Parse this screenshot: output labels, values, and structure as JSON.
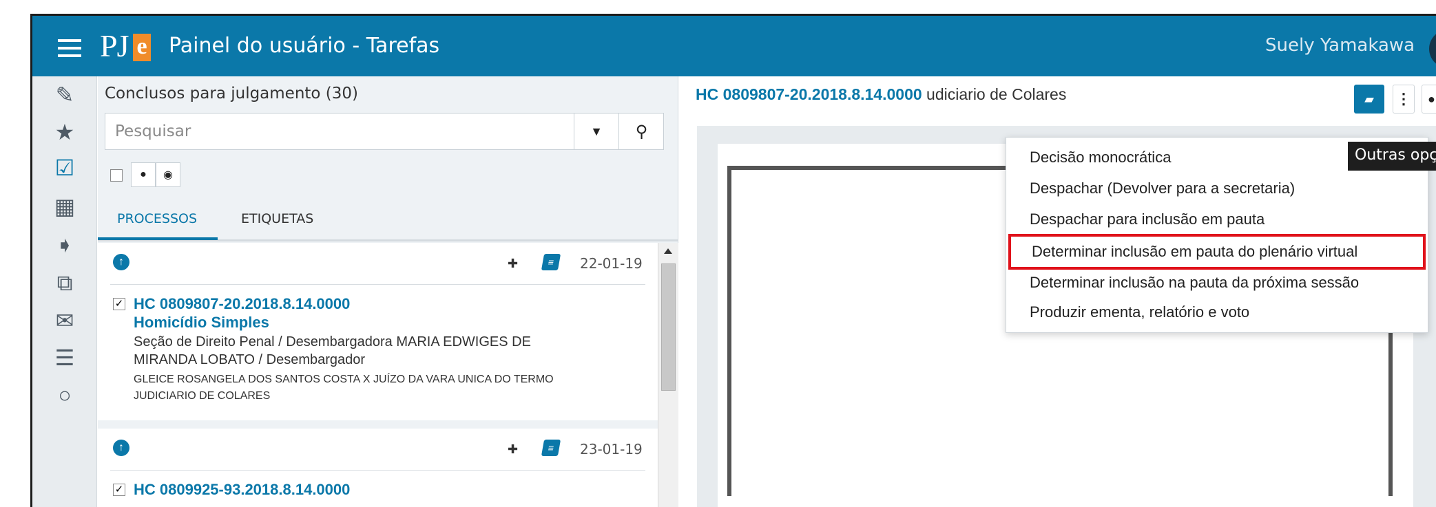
{
  "header": {
    "logo_text": "PJe",
    "title": "Painel do usuário - Tarefas",
    "user_name": "Suely Yamakawa"
  },
  "rail": {
    "icons": [
      "pencil-icon",
      "star-icon",
      "checkbox-icon",
      "calendar-icon",
      "tags-icon",
      "copy-icon",
      "envelope-icon",
      "server-icon",
      "search-icon"
    ],
    "active": "checkbox-icon"
  },
  "list": {
    "title": "Conclusos para julgamento (30)",
    "search_placeholder": "Pesquisar",
    "tabs": [
      "PROCESSOS",
      "ETIQUETAS"
    ],
    "active_tab": "PROCESSOS",
    "items": [
      {
        "date": "22-01-19",
        "process": "HC 0809807-20.2018.8.14.0000",
        "class": "Homicídio Simples",
        "organ": "Seção de Direito Penal / Desembargadora MARIA EDWIGES DE MIRANDA LOBATO / Desembargador",
        "parties": "GLEICE ROSANGELA DOS SANTOS COSTA X JUÍZO DA VARA UNICA DO TERMO JUDICIARIO DE COLARES",
        "checked": true
      },
      {
        "date": "23-01-19",
        "process": "HC 0809925-93.2018.8.14.0000",
        "checked": true
      }
    ]
  },
  "detail": {
    "process_number": "HC 0809807-20.2018.8.14.0000",
    "process_suffix": " udiciario de Colares",
    "tag_count": "0",
    "tooltip": "Outras opções",
    "menu_items": [
      "Decisão monocrática",
      "Despachar (Devolver para a secretaria)",
      "Despachar para inclusão em pauta",
      "Determinar inclusão em pauta do plenário virtual",
      "Determinar inclusão na pauta da próxima sessão",
      "Produzir ementa, relatório e voto"
    ],
    "highlighted_index": 3
  },
  "colors": {
    "brand": "#0b78a9",
    "logo_accent": "#f08c2a",
    "highlight": "#e0121b"
  }
}
